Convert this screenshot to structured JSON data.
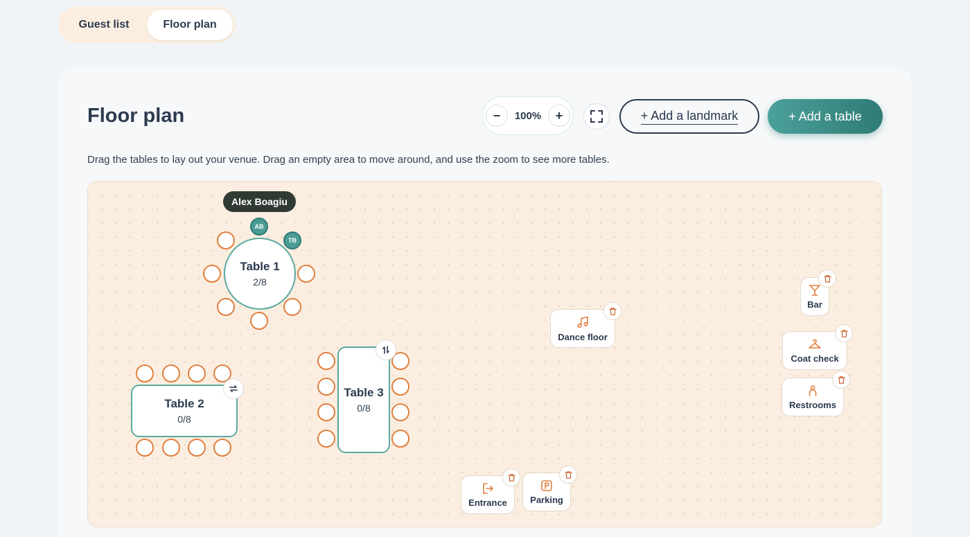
{
  "tabs": [
    {
      "label": "Guest list",
      "active": false
    },
    {
      "label": "Floor plan",
      "active": true
    }
  ],
  "header": {
    "title": "Floor plan",
    "zoom_level": "100%",
    "zoom_out_label": "−",
    "zoom_in_label": "+",
    "add_landmark_label": "+ Add a landmark",
    "add_table_label": "+ Add a table"
  },
  "description": "Drag the tables to lay out your venue. Drag an empty area to move around, and use the zoom to see more tables.",
  "tooltip": "Alex Boagiu",
  "tables": [
    {
      "name": "Table 1",
      "count": "2/8",
      "shape": "round",
      "guests": [
        "AB",
        "TB"
      ]
    },
    {
      "name": "Table 2",
      "count": "0/8",
      "shape": "rect"
    },
    {
      "name": "Table 3",
      "count": "0/8",
      "shape": "rect"
    }
  ],
  "landmarks": [
    {
      "label": "Dance floor",
      "icon": "music-note-icon"
    },
    {
      "label": "Bar",
      "icon": "cocktail-icon"
    },
    {
      "label": "Coat check",
      "icon": "hanger-icon"
    },
    {
      "label": "Restrooms",
      "icon": "person-icon"
    },
    {
      "label": "Entrance",
      "icon": "entrance-icon"
    },
    {
      "label": "Parking",
      "icon": "parking-icon"
    }
  ],
  "colors": {
    "accent": "#4a9c95",
    "seat": "#e07f3e",
    "canvas": "#fbeee0",
    "text": "#2c3a4f"
  }
}
